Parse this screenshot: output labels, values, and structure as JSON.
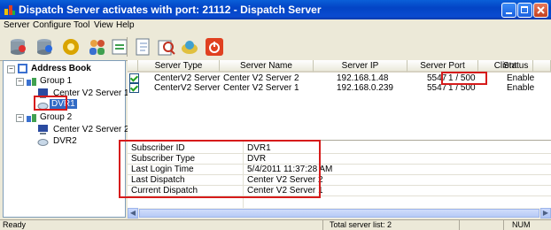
{
  "window": {
    "title": "Dispatch Server activates with port: 21112 - Dispatch Server"
  },
  "menu": [
    "Server",
    "Configure",
    "Tool",
    "View",
    "Help"
  ],
  "toolbar": [
    "server-icon",
    "server-add-icon",
    "gear-icon",
    "users-icon",
    "import-icon",
    "export-icon",
    "search-icon",
    "help-icon",
    "power-icon"
  ],
  "tree": {
    "root": "Address Book",
    "group1": "Group 1",
    "g1_server": "Center V2 Server 1",
    "g1_dvr": "DVR1",
    "group2": "Group 2",
    "g2_server": "Center V2 Server 2",
    "g2_dvr": "DVR2"
  },
  "table": {
    "headers": [
      "Server Type",
      "Server Name",
      "Server IP",
      "Server Port",
      "Client",
      "Status"
    ],
    "rows": [
      [
        "CenterV2 Server",
        "Center V2 Server 2",
        "192.168.1.48",
        "5547",
        "1 / 500",
        "Enable"
      ],
      [
        "CenterV2 Server",
        "Center V2 Server 1",
        "192.168.0.239",
        "5547",
        "1 / 500",
        "Enable"
      ]
    ]
  },
  "details": [
    {
      "label": "Subscriber ID",
      "value": "DVR1"
    },
    {
      "label": "Subscriber Type",
      "value": "DVR"
    },
    {
      "label": "Last Login Time",
      "value": "5/4/2011 11:37:28 AM"
    },
    {
      "label": "Last Dispatch",
      "value": "Center V2 Server 2"
    },
    {
      "label": "Current Dispatch",
      "value": "Center V2 Server 1"
    }
  ],
  "status": {
    "left": "Ready",
    "middle": "Total server list: 2",
    "right": "NUM"
  },
  "colors": {
    "title_bar": "#0a4bd0",
    "highlight_box": "#d61b1b",
    "selected_item": "#316ac5"
  }
}
